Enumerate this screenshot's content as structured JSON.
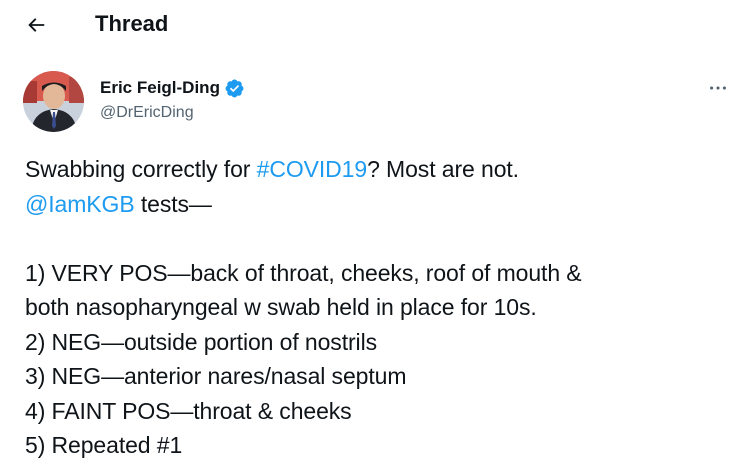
{
  "header": {
    "back_icon": "arrow-left-icon",
    "title": "Thread"
  },
  "author": {
    "name": "Eric Feigl-Ding",
    "handle": "@DrEricDing",
    "verified": true,
    "verified_color": "#1d9bf0"
  },
  "tweet": {
    "line1": {
      "pre": "Swabbing correctly for ",
      "hashtag": "#COVID19",
      "post": "? Most are not."
    },
    "line2": {
      "mention": "@IamKGB",
      "post": " tests—"
    },
    "line3": "1) VERY POS—back of throat, cheeks, roof of mouth &",
    "line4": "both nasopharyngeal w swab held in place for 10s.",
    "line5": "2) NEG—outside portion of nostrils",
    "line6": "3) NEG—anterior nares/nasal septum",
    "line7": "4) FAINT POS—throat & cheeks",
    "line8": "5) Repeated #1"
  },
  "colors": {
    "link": "#1d9bf0",
    "text": "#0f1419",
    "secondary": "#536471"
  }
}
